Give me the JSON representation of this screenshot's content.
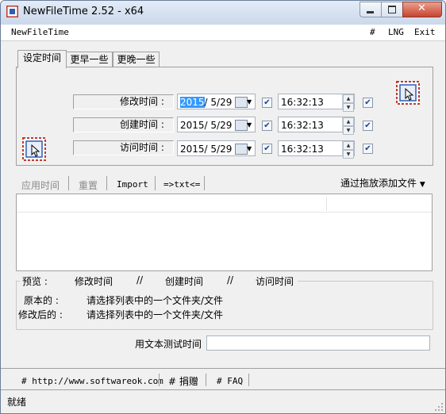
{
  "window": {
    "title": "NewFileTime 2.52 - x64"
  },
  "menu": {
    "app_name": "NewFileTime",
    "hash": "#",
    "lng": "LNG",
    "exit": "Exit"
  },
  "tabs": [
    {
      "label": "设定时间"
    },
    {
      "label": "更早一些"
    },
    {
      "label": "更晚一些"
    }
  ],
  "rows": [
    {
      "label": "修改时间 :",
      "date": "2015/ 5/29",
      "date_year_selected": "2015",
      "date_rest": "/ 5/29",
      "time": "16:32:13",
      "date_checked": true,
      "time_checked": true
    },
    {
      "label": "创建时间 :",
      "date": "2015/ 5/29",
      "time": "16:32:13",
      "date_checked": true,
      "time_checked": true
    },
    {
      "label": "访问时间 :",
      "date": "2015/ 5/29",
      "time": "16:32:13",
      "date_checked": true,
      "time_checked": true
    }
  ],
  "toolbar": {
    "apply": "应用时间",
    "reset": "重置",
    "import": "Import",
    "txt": "=>txt<=",
    "drag_hint": "通过拖放添加文件"
  },
  "preview": {
    "label": "预览 :",
    "modified": "修改时间",
    "sep1": "//",
    "created": "创建时间",
    "sep2": "//",
    "accessed": "访问时间",
    "original_label": "原本的 :",
    "original_value": "请选择列表中的一个文件夹/文件",
    "modified_label": "修改后的 :",
    "modified_value": "请选择列表中的一个文件夹/文件"
  },
  "test": {
    "label": "用文本测试时间",
    "value": ""
  },
  "links": {
    "website": "# http://www.softwareok.com",
    "donate": "# 捐赠",
    "faq": "# FAQ"
  },
  "status": {
    "text": "就绪"
  },
  "colors": {
    "selection": "#3399ff",
    "titlebar": "#cad8ea",
    "close_button": "#c8442f"
  }
}
